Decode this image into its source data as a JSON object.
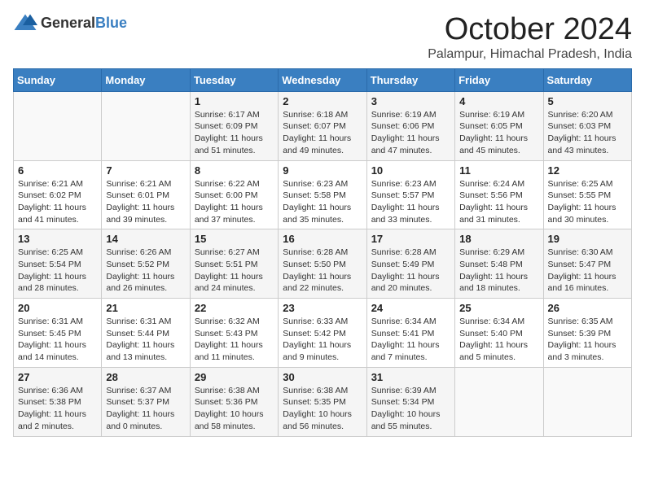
{
  "header": {
    "logo_general": "General",
    "logo_blue": "Blue",
    "month_title": "October 2024",
    "subtitle": "Palampur, Himachal Pradesh, India"
  },
  "days_of_week": [
    "Sunday",
    "Monday",
    "Tuesday",
    "Wednesday",
    "Thursday",
    "Friday",
    "Saturday"
  ],
  "weeks": [
    [
      {
        "day": "",
        "sunrise": "",
        "sunset": "",
        "daylight": ""
      },
      {
        "day": "",
        "sunrise": "",
        "sunset": "",
        "daylight": ""
      },
      {
        "day": "1",
        "sunrise": "Sunrise: 6:17 AM",
        "sunset": "Sunset: 6:09 PM",
        "daylight": "Daylight: 11 hours and 51 minutes."
      },
      {
        "day": "2",
        "sunrise": "Sunrise: 6:18 AM",
        "sunset": "Sunset: 6:07 PM",
        "daylight": "Daylight: 11 hours and 49 minutes."
      },
      {
        "day": "3",
        "sunrise": "Sunrise: 6:19 AM",
        "sunset": "Sunset: 6:06 PM",
        "daylight": "Daylight: 11 hours and 47 minutes."
      },
      {
        "day": "4",
        "sunrise": "Sunrise: 6:19 AM",
        "sunset": "Sunset: 6:05 PM",
        "daylight": "Daylight: 11 hours and 45 minutes."
      },
      {
        "day": "5",
        "sunrise": "Sunrise: 6:20 AM",
        "sunset": "Sunset: 6:03 PM",
        "daylight": "Daylight: 11 hours and 43 minutes."
      }
    ],
    [
      {
        "day": "6",
        "sunrise": "Sunrise: 6:21 AM",
        "sunset": "Sunset: 6:02 PM",
        "daylight": "Daylight: 11 hours and 41 minutes."
      },
      {
        "day": "7",
        "sunrise": "Sunrise: 6:21 AM",
        "sunset": "Sunset: 6:01 PM",
        "daylight": "Daylight: 11 hours and 39 minutes."
      },
      {
        "day": "8",
        "sunrise": "Sunrise: 6:22 AM",
        "sunset": "Sunset: 6:00 PM",
        "daylight": "Daylight: 11 hours and 37 minutes."
      },
      {
        "day": "9",
        "sunrise": "Sunrise: 6:23 AM",
        "sunset": "Sunset: 5:58 PM",
        "daylight": "Daylight: 11 hours and 35 minutes."
      },
      {
        "day": "10",
        "sunrise": "Sunrise: 6:23 AM",
        "sunset": "Sunset: 5:57 PM",
        "daylight": "Daylight: 11 hours and 33 minutes."
      },
      {
        "day": "11",
        "sunrise": "Sunrise: 6:24 AM",
        "sunset": "Sunset: 5:56 PM",
        "daylight": "Daylight: 11 hours and 31 minutes."
      },
      {
        "day": "12",
        "sunrise": "Sunrise: 6:25 AM",
        "sunset": "Sunset: 5:55 PM",
        "daylight": "Daylight: 11 hours and 30 minutes."
      }
    ],
    [
      {
        "day": "13",
        "sunrise": "Sunrise: 6:25 AM",
        "sunset": "Sunset: 5:54 PM",
        "daylight": "Daylight: 11 hours and 28 minutes."
      },
      {
        "day": "14",
        "sunrise": "Sunrise: 6:26 AM",
        "sunset": "Sunset: 5:52 PM",
        "daylight": "Daylight: 11 hours and 26 minutes."
      },
      {
        "day": "15",
        "sunrise": "Sunrise: 6:27 AM",
        "sunset": "Sunset: 5:51 PM",
        "daylight": "Daylight: 11 hours and 24 minutes."
      },
      {
        "day": "16",
        "sunrise": "Sunrise: 6:28 AM",
        "sunset": "Sunset: 5:50 PM",
        "daylight": "Daylight: 11 hours and 22 minutes."
      },
      {
        "day": "17",
        "sunrise": "Sunrise: 6:28 AM",
        "sunset": "Sunset: 5:49 PM",
        "daylight": "Daylight: 11 hours and 20 minutes."
      },
      {
        "day": "18",
        "sunrise": "Sunrise: 6:29 AM",
        "sunset": "Sunset: 5:48 PM",
        "daylight": "Daylight: 11 hours and 18 minutes."
      },
      {
        "day": "19",
        "sunrise": "Sunrise: 6:30 AM",
        "sunset": "Sunset: 5:47 PM",
        "daylight": "Daylight: 11 hours and 16 minutes."
      }
    ],
    [
      {
        "day": "20",
        "sunrise": "Sunrise: 6:31 AM",
        "sunset": "Sunset: 5:45 PM",
        "daylight": "Daylight: 11 hours and 14 minutes."
      },
      {
        "day": "21",
        "sunrise": "Sunrise: 6:31 AM",
        "sunset": "Sunset: 5:44 PM",
        "daylight": "Daylight: 11 hours and 13 minutes."
      },
      {
        "day": "22",
        "sunrise": "Sunrise: 6:32 AM",
        "sunset": "Sunset: 5:43 PM",
        "daylight": "Daylight: 11 hours and 11 minutes."
      },
      {
        "day": "23",
        "sunrise": "Sunrise: 6:33 AM",
        "sunset": "Sunset: 5:42 PM",
        "daylight": "Daylight: 11 hours and 9 minutes."
      },
      {
        "day": "24",
        "sunrise": "Sunrise: 6:34 AM",
        "sunset": "Sunset: 5:41 PM",
        "daylight": "Daylight: 11 hours and 7 minutes."
      },
      {
        "day": "25",
        "sunrise": "Sunrise: 6:34 AM",
        "sunset": "Sunset: 5:40 PM",
        "daylight": "Daylight: 11 hours and 5 minutes."
      },
      {
        "day": "26",
        "sunrise": "Sunrise: 6:35 AM",
        "sunset": "Sunset: 5:39 PM",
        "daylight": "Daylight: 11 hours and 3 minutes."
      }
    ],
    [
      {
        "day": "27",
        "sunrise": "Sunrise: 6:36 AM",
        "sunset": "Sunset: 5:38 PM",
        "daylight": "Daylight: 11 hours and 2 minutes."
      },
      {
        "day": "28",
        "sunrise": "Sunrise: 6:37 AM",
        "sunset": "Sunset: 5:37 PM",
        "daylight": "Daylight: 11 hours and 0 minutes."
      },
      {
        "day": "29",
        "sunrise": "Sunrise: 6:38 AM",
        "sunset": "Sunset: 5:36 PM",
        "daylight": "Daylight: 10 hours and 58 minutes."
      },
      {
        "day": "30",
        "sunrise": "Sunrise: 6:38 AM",
        "sunset": "Sunset: 5:35 PM",
        "daylight": "Daylight: 10 hours and 56 minutes."
      },
      {
        "day": "31",
        "sunrise": "Sunrise: 6:39 AM",
        "sunset": "Sunset: 5:34 PM",
        "daylight": "Daylight: 10 hours and 55 minutes."
      },
      {
        "day": "",
        "sunrise": "",
        "sunset": "",
        "daylight": ""
      },
      {
        "day": "",
        "sunrise": "",
        "sunset": "",
        "daylight": ""
      }
    ]
  ]
}
